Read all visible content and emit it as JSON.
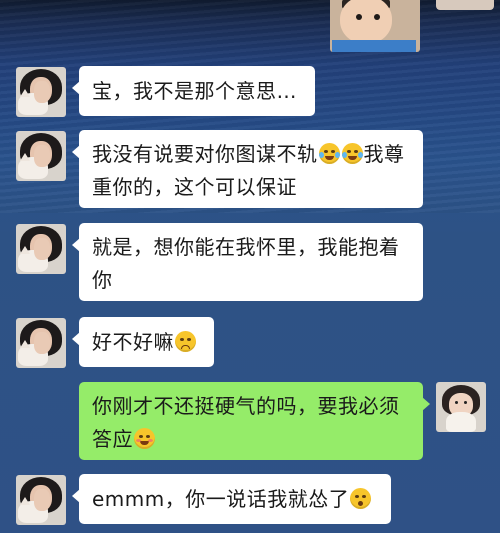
{
  "messages": [
    {
      "side": "left",
      "text": "宝，我不是那个意思…",
      "emoji": []
    },
    {
      "side": "left",
      "text_a": "我没有说要对你图谋不轨",
      "emoji": [
        "laughing-tears-emoji",
        "laughing-tears-emoji"
      ],
      "text_b": "我尊",
      "line2": "重你的，这个可以保证"
    },
    {
      "side": "left",
      "line1": "就是，想你能在我怀里，我能抱着",
      "line2": "你"
    },
    {
      "side": "left",
      "text": "好不好嘛",
      "emoji": [
        "frowning-emoji"
      ]
    },
    {
      "side": "right",
      "line1": "你刚才不还挺硬气的吗，要我必须",
      "line2": "答应",
      "emoji": [
        "flushed-emoji"
      ]
    },
    {
      "side": "left",
      "text": "emmm，你一说话我就怂了",
      "emoji": [
        "nervous-emoji"
      ]
    }
  ],
  "colors": {
    "received_bubble": "#ffffff",
    "sent_bubble": "#95ec69",
    "background": "#2c4a7c"
  },
  "avatars": {
    "contact": "girl-with-cat-avatar",
    "self": "girl-with-cat-avatar-self",
    "top": "baby-avatar"
  }
}
